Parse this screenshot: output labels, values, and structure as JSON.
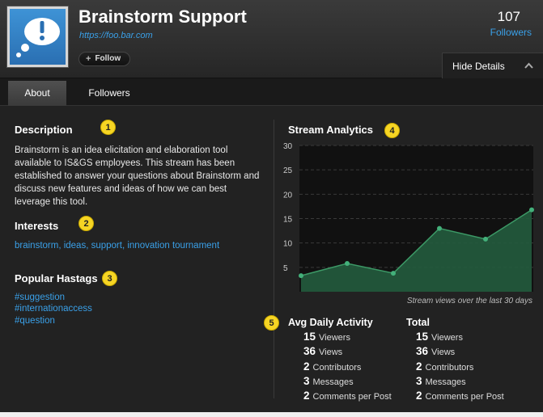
{
  "header": {
    "title": "Brainstorm Support",
    "url": "https://foo.bar.com",
    "follow_label": "Follow",
    "follow_icon": "plus-icon",
    "followers_count": "107",
    "followers_label": "Followers",
    "hide_details_label": "Hide Details"
  },
  "tabs": [
    {
      "label": "About",
      "active": true
    },
    {
      "label": "Followers",
      "active": false
    }
  ],
  "about": {
    "description_heading": "Description",
    "description": "Brainstorm is an idea elicitation and elaboration tool available to IS&GS employees.  This stream has been established to answer your questions about Brainstorm and discuss new features and ideas of how we can best leverage this tool.",
    "interests_heading": "Interests",
    "interests": "brainstorm,  ideas,  support,  innovation tournament",
    "hashtags_heading": "Popular Hastags",
    "hashtags": [
      "#suggestion",
      "#internationaccess",
      "#question"
    ]
  },
  "badges": [
    "1",
    "2",
    "3",
    "4",
    "5"
  ],
  "analytics": {
    "heading": "Stream Analytics",
    "caption": "Stream views over the last 30 days"
  },
  "chart_data": {
    "type": "area",
    "title": "Stream Analytics",
    "x": [
      1,
      2,
      3,
      4,
      5,
      6
    ],
    "values": [
      3.3,
      5.8,
      3.8,
      13.0,
      10.8,
      16.8
    ],
    "ylim": [
      0,
      30
    ],
    "yticks": [
      "30",
      "25",
      "20",
      "15",
      "10",
      "5"
    ],
    "grid": true,
    "colors": {
      "fill": "#245c3e",
      "line": "#3c9966",
      "point": "#43b07a",
      "plot_bg": "#111111",
      "grid": "#3a3a3a"
    }
  },
  "stats": {
    "avg_heading": "Avg Daily Activity",
    "total_heading": "Total",
    "avg": [
      {
        "num": "15",
        "label": "Viewers"
      },
      {
        "num": "36",
        "label": "Views"
      },
      {
        "num": "2",
        "label": "Contributors"
      },
      {
        "num": "3",
        "label": "Messages"
      },
      {
        "num": "2",
        "label": "Comments per Post"
      }
    ],
    "total": [
      {
        "num": "15",
        "label": "Viewers"
      },
      {
        "num": "36",
        "label": "Views"
      },
      {
        "num": "2",
        "label": "Contributors"
      },
      {
        "num": "3",
        "label": "Messages"
      },
      {
        "num": "2",
        "label": "Comments per Post"
      }
    ]
  },
  "colors": {
    "accent": "#3aa0e8",
    "badge": "#f6d524",
    "background": "#222222"
  }
}
